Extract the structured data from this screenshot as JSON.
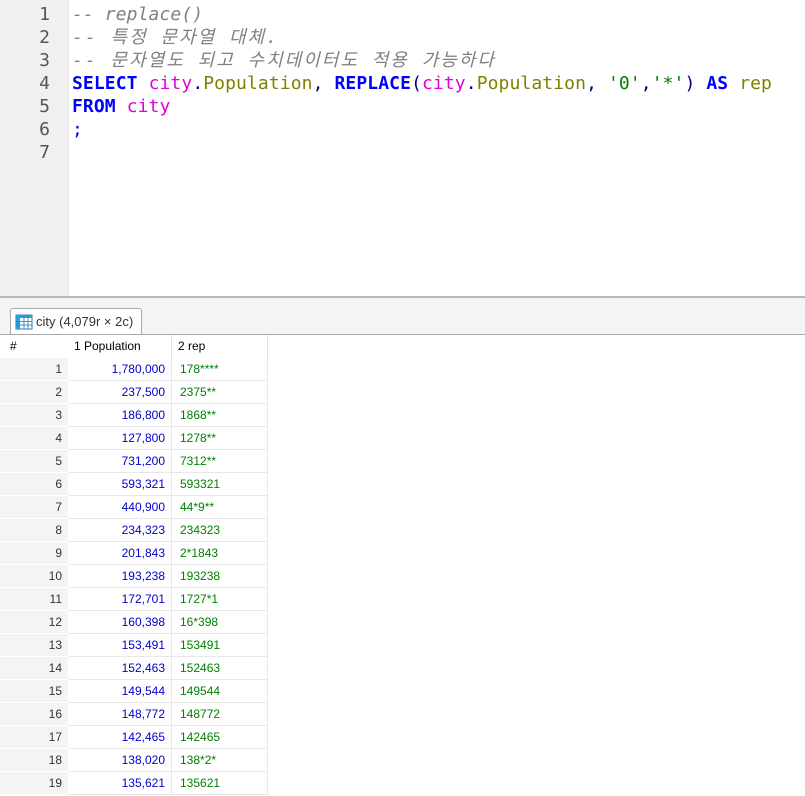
{
  "editor": {
    "line_numbers": [
      "1",
      "2",
      "3",
      "4",
      "5",
      "6",
      "7"
    ],
    "line1": "-- replace()",
    "line2": "-- 특정 문자열 대체.",
    "line3": "-- 문자열도 되고 수치데이터도 적용 가능하다",
    "l4_select": "SELECT",
    "l4_city1": "city",
    "l4_dot1": ".",
    "l4_pop1": "Population",
    "l4_comma1": ",",
    "l4_replace": "REPLACE",
    "l4_paren_open": "(",
    "l4_city2": "city",
    "l4_dot2": ".",
    "l4_pop2": "Population",
    "l4_comma2": ",",
    "l4_str1": "'0'",
    "l4_comma3": ",",
    "l4_str2": "'*'",
    "l4_paren_close": ")",
    "l4_as": "AS",
    "l4_alias": "rep",
    "l5_from": "FROM",
    "l5_table": "city",
    "l6_semicolon": ";"
  },
  "result_tab": {
    "label": "city (4,079r × 2c)",
    "icon": "table-grid-icon"
  },
  "grid": {
    "rownum_header": "#",
    "columns": [
      "1 Population",
      "2 rep"
    ],
    "rows": [
      {
        "n": "1",
        "population": "1,780,000",
        "rep": "178****"
      },
      {
        "n": "2",
        "population": "237,500",
        "rep": "2375**"
      },
      {
        "n": "3",
        "population": "186,800",
        "rep": "1868**"
      },
      {
        "n": "4",
        "population": "127,800",
        "rep": "1278**"
      },
      {
        "n": "5",
        "population": "731,200",
        "rep": "7312**"
      },
      {
        "n": "6",
        "population": "593,321",
        "rep": "593321"
      },
      {
        "n": "7",
        "population": "440,900",
        "rep": "44*9**"
      },
      {
        "n": "8",
        "population": "234,323",
        "rep": "234323"
      },
      {
        "n": "9",
        "population": "201,843",
        "rep": "2*1843"
      },
      {
        "n": "10",
        "population": "193,238",
        "rep": "193238"
      },
      {
        "n": "11",
        "population": "172,701",
        "rep": "1727*1"
      },
      {
        "n": "12",
        "population": "160,398",
        "rep": "16*398"
      },
      {
        "n": "13",
        "population": "153,491",
        "rep": "153491"
      },
      {
        "n": "14",
        "population": "152,463",
        "rep": "152463"
      },
      {
        "n": "15",
        "population": "149,544",
        "rep": "149544"
      },
      {
        "n": "16",
        "population": "148,772",
        "rep": "148772"
      },
      {
        "n": "17",
        "population": "142,465",
        "rep": "142465"
      },
      {
        "n": "18",
        "population": "138,020",
        "rep": "138*2*"
      },
      {
        "n": "19",
        "population": "135,621",
        "rep": "135621"
      }
    ]
  },
  "colors": {
    "keyword": "#0000ff",
    "table": "#e000e0",
    "column": "#808000",
    "string": "#008000",
    "comment": "#808080",
    "number_cell": "#0000cc",
    "text_cell": "#008000"
  }
}
